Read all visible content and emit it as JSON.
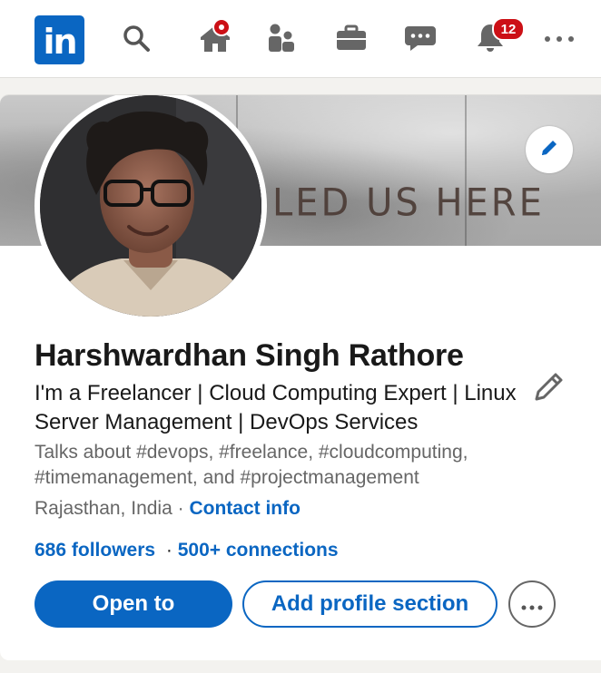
{
  "nav": {
    "logo": "in",
    "icons": [
      "search-icon",
      "home-icon",
      "my-network-icon",
      "jobs-icon",
      "messaging-icon",
      "notifications-icon",
      "more-icon"
    ],
    "notifications_count": "12",
    "accent": "#0a66c2",
    "badge_color": "#cc1016"
  },
  "cover": {
    "text": "LED US HERE"
  },
  "profile": {
    "name": "Harshwardhan Singh Rathore",
    "headline": "I'm a Freelancer | Cloud Computing Expert | Linux Server Management | DevOps Services",
    "talks_about": "Talks about #devops, #freelance, #cloudcomputing, #timemanagement, and #projectmanagement",
    "location": "Rajasthan, India",
    "separator": " · ",
    "contact_info": "Contact info",
    "followers": "686 followers",
    "connections": "500+ connections"
  },
  "actions": {
    "open_to": "Open to",
    "add_section": "Add profile section"
  }
}
